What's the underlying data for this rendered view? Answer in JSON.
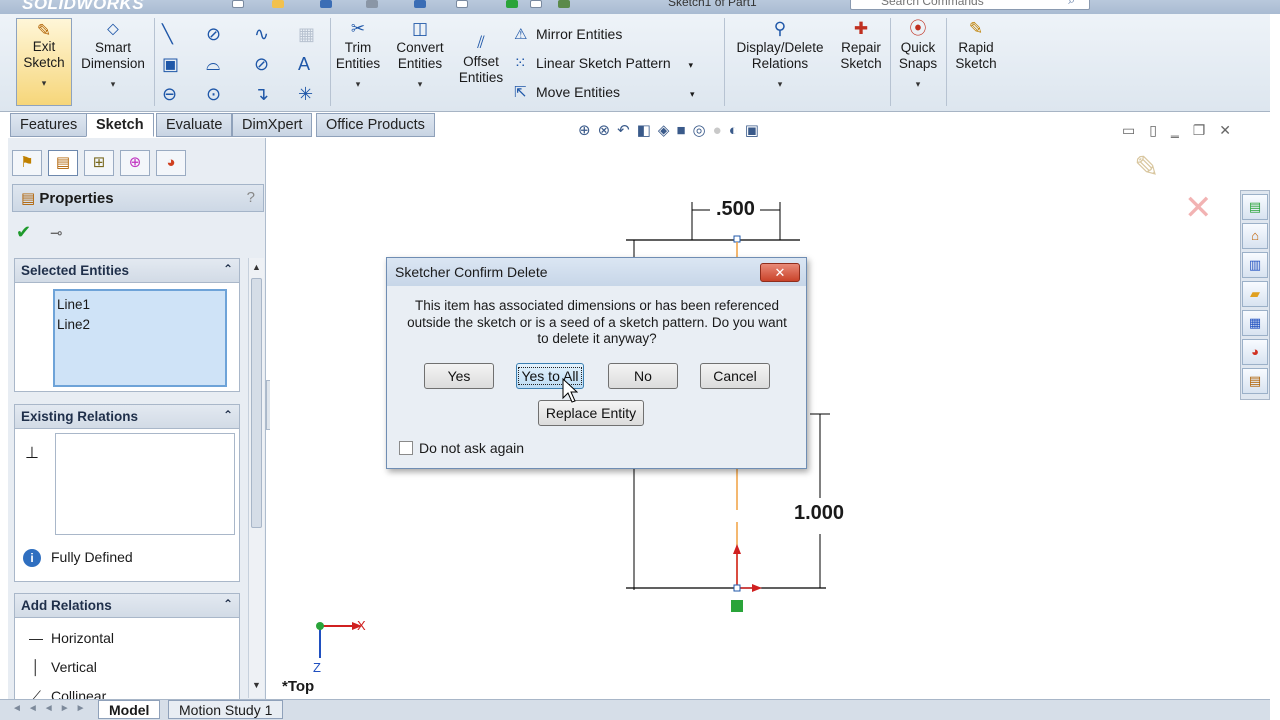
{
  "app": {
    "logo": "SOLIDWORKS",
    "document_title": "Sketch1 of Part1",
    "search_placeholder": "Search Commands"
  },
  "command_manager": {
    "exit_sketch": "Exit Sketch",
    "smart_dimension": "Smart Dimension",
    "trim_entities": "Trim Entities",
    "convert_entities": "Convert Entities",
    "offset_entities": "Offset Entities",
    "mirror_entities": "Mirror Entities",
    "linear_sketch_pattern": "Linear Sketch Pattern",
    "move_entities": "Move Entities",
    "display_delete_relations": "Display/Delete Relations",
    "repair_sketch": "Repair Sketch",
    "quick_snaps": "Quick Snaps",
    "rapid_sketch": "Rapid Sketch"
  },
  "tabs": [
    "Features",
    "Sketch",
    "Evaluate",
    "DimXpert",
    "Office Products"
  ],
  "active_tab": "Sketch",
  "property_manager": {
    "title": "Properties",
    "help": "?",
    "selected_entities": {
      "header": "Selected Entities",
      "items": [
        "Line1",
        "Line2"
      ]
    },
    "existing_relations": {
      "header": "Existing Relations",
      "status": "Fully Defined"
    },
    "add_relations": {
      "header": "Add Relations",
      "items": [
        "Horizontal",
        "Vertical",
        "Collinear"
      ]
    }
  },
  "graphics": {
    "view_label": "*Top",
    "dim_top": ".500",
    "dim_right": "1.000",
    "axis_x": "X",
    "axis_y": "Z"
  },
  "dialog": {
    "title": "Sketcher Confirm Delete",
    "close": "✕",
    "message": "This item has associated dimensions or has been referenced outside the sketch or is a seed of a sketch pattern. Do you want to delete it anyway?",
    "buttons": {
      "yes": "Yes",
      "yes_to_all": "Yes to All",
      "no": "No",
      "cancel": "Cancel",
      "replace_entity": "Replace Entity"
    },
    "checkbox_label": "Do not ask again"
  },
  "bottom_tabs": [
    "Model",
    "Motion Study 1"
  ],
  "active_bottom_tab": "Model",
  "colors": {
    "accent_blue": "#1f57a8",
    "sketch_orange": "#f0a040",
    "ok_green": "#1e9a2b",
    "close_red": "#c9432a"
  }
}
